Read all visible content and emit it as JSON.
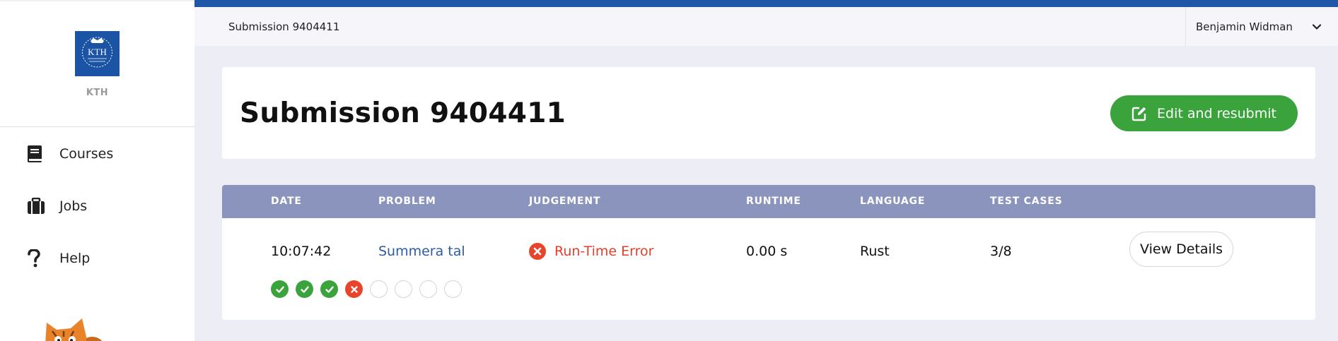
{
  "sidebar": {
    "logo_text": "KTH",
    "logo_mark": "KTH",
    "items": [
      {
        "label": "Courses",
        "icon": "book-icon"
      },
      {
        "label": "Jobs",
        "icon": "briefcase-icon"
      },
      {
        "label": "Help",
        "icon": "question-icon"
      }
    ]
  },
  "topbar": {
    "breadcrumb": "Submission 9404411",
    "user_name": "Benjamin Widman"
  },
  "header": {
    "title": "Submission 9404411",
    "resubmit_label": "Edit and resubmit"
  },
  "table": {
    "columns": [
      "DATE",
      "PROBLEM",
      "JUDGEMENT",
      "RUNTIME",
      "LANGUAGE",
      "TEST CASES"
    ],
    "row": {
      "date": "10:07:42",
      "problem": "Summera tal",
      "judgement": "Run-Time Error",
      "runtime": "0.00 s",
      "language": "Rust",
      "test_cases": "3/8",
      "details_label": "View Details"
    },
    "test_case_results": [
      "pass",
      "pass",
      "pass",
      "fail",
      "none",
      "none",
      "none",
      "none"
    ]
  },
  "colors": {
    "accent": "#1f56a7",
    "success": "#3aa33c",
    "error": "#e2402a",
    "table_header": "#8b94bd"
  }
}
